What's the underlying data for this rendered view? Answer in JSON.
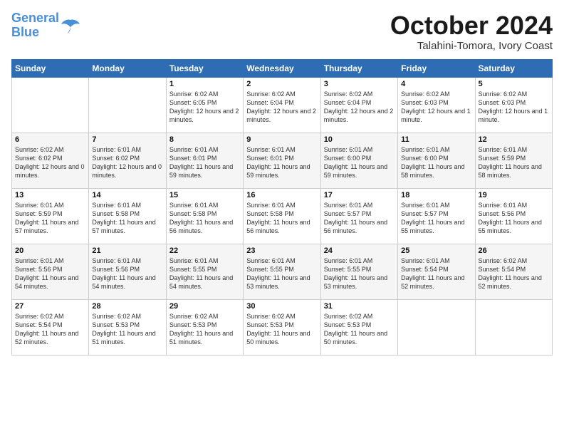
{
  "header": {
    "logo_line1": "General",
    "logo_line2": "Blue",
    "month": "October 2024",
    "location": "Talahini-Tomora, Ivory Coast"
  },
  "weekdays": [
    "Sunday",
    "Monday",
    "Tuesday",
    "Wednesday",
    "Thursday",
    "Friday",
    "Saturday"
  ],
  "weeks": [
    [
      {
        "day": "",
        "info": ""
      },
      {
        "day": "",
        "info": ""
      },
      {
        "day": "1",
        "info": "Sunrise: 6:02 AM\nSunset: 6:05 PM\nDaylight: 12 hours and 2 minutes."
      },
      {
        "day": "2",
        "info": "Sunrise: 6:02 AM\nSunset: 6:04 PM\nDaylight: 12 hours and 2 minutes."
      },
      {
        "day": "3",
        "info": "Sunrise: 6:02 AM\nSunset: 6:04 PM\nDaylight: 12 hours and 2 minutes."
      },
      {
        "day": "4",
        "info": "Sunrise: 6:02 AM\nSunset: 6:03 PM\nDaylight: 12 hours and 1 minute."
      },
      {
        "day": "5",
        "info": "Sunrise: 6:02 AM\nSunset: 6:03 PM\nDaylight: 12 hours and 1 minute."
      }
    ],
    [
      {
        "day": "6",
        "info": "Sunrise: 6:02 AM\nSunset: 6:02 PM\nDaylight: 12 hours and 0 minutes."
      },
      {
        "day": "7",
        "info": "Sunrise: 6:01 AM\nSunset: 6:02 PM\nDaylight: 12 hours and 0 minutes."
      },
      {
        "day": "8",
        "info": "Sunrise: 6:01 AM\nSunset: 6:01 PM\nDaylight: 11 hours and 59 minutes."
      },
      {
        "day": "9",
        "info": "Sunrise: 6:01 AM\nSunset: 6:01 PM\nDaylight: 11 hours and 59 minutes."
      },
      {
        "day": "10",
        "info": "Sunrise: 6:01 AM\nSunset: 6:00 PM\nDaylight: 11 hours and 59 minutes."
      },
      {
        "day": "11",
        "info": "Sunrise: 6:01 AM\nSunset: 6:00 PM\nDaylight: 11 hours and 58 minutes."
      },
      {
        "day": "12",
        "info": "Sunrise: 6:01 AM\nSunset: 5:59 PM\nDaylight: 11 hours and 58 minutes."
      }
    ],
    [
      {
        "day": "13",
        "info": "Sunrise: 6:01 AM\nSunset: 5:59 PM\nDaylight: 11 hours and 57 minutes."
      },
      {
        "day": "14",
        "info": "Sunrise: 6:01 AM\nSunset: 5:58 PM\nDaylight: 11 hours and 57 minutes."
      },
      {
        "day": "15",
        "info": "Sunrise: 6:01 AM\nSunset: 5:58 PM\nDaylight: 11 hours and 56 minutes."
      },
      {
        "day": "16",
        "info": "Sunrise: 6:01 AM\nSunset: 5:58 PM\nDaylight: 11 hours and 56 minutes."
      },
      {
        "day": "17",
        "info": "Sunrise: 6:01 AM\nSunset: 5:57 PM\nDaylight: 11 hours and 56 minutes."
      },
      {
        "day": "18",
        "info": "Sunrise: 6:01 AM\nSunset: 5:57 PM\nDaylight: 11 hours and 55 minutes."
      },
      {
        "day": "19",
        "info": "Sunrise: 6:01 AM\nSunset: 5:56 PM\nDaylight: 11 hours and 55 minutes."
      }
    ],
    [
      {
        "day": "20",
        "info": "Sunrise: 6:01 AM\nSunset: 5:56 PM\nDaylight: 11 hours and 54 minutes."
      },
      {
        "day": "21",
        "info": "Sunrise: 6:01 AM\nSunset: 5:56 PM\nDaylight: 11 hours and 54 minutes."
      },
      {
        "day": "22",
        "info": "Sunrise: 6:01 AM\nSunset: 5:55 PM\nDaylight: 11 hours and 54 minutes."
      },
      {
        "day": "23",
        "info": "Sunrise: 6:01 AM\nSunset: 5:55 PM\nDaylight: 11 hours and 53 minutes."
      },
      {
        "day": "24",
        "info": "Sunrise: 6:01 AM\nSunset: 5:55 PM\nDaylight: 11 hours and 53 minutes."
      },
      {
        "day": "25",
        "info": "Sunrise: 6:01 AM\nSunset: 5:54 PM\nDaylight: 11 hours and 52 minutes."
      },
      {
        "day": "26",
        "info": "Sunrise: 6:02 AM\nSunset: 5:54 PM\nDaylight: 11 hours and 52 minutes."
      }
    ],
    [
      {
        "day": "27",
        "info": "Sunrise: 6:02 AM\nSunset: 5:54 PM\nDaylight: 11 hours and 52 minutes."
      },
      {
        "day": "28",
        "info": "Sunrise: 6:02 AM\nSunset: 5:53 PM\nDaylight: 11 hours and 51 minutes."
      },
      {
        "day": "29",
        "info": "Sunrise: 6:02 AM\nSunset: 5:53 PM\nDaylight: 11 hours and 51 minutes."
      },
      {
        "day": "30",
        "info": "Sunrise: 6:02 AM\nSunset: 5:53 PM\nDaylight: 11 hours and 50 minutes."
      },
      {
        "day": "31",
        "info": "Sunrise: 6:02 AM\nSunset: 5:53 PM\nDaylight: 11 hours and 50 minutes."
      },
      {
        "day": "",
        "info": ""
      },
      {
        "day": "",
        "info": ""
      }
    ]
  ]
}
